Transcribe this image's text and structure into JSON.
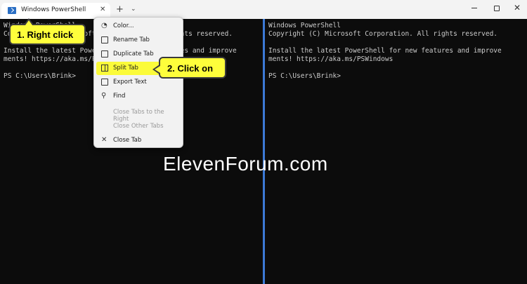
{
  "tab": {
    "title": "Windows PowerShell",
    "close_glyph": "✕"
  },
  "tabbar": {
    "new_tab_glyph": "+",
    "dropdown_glyph": "⌄"
  },
  "window_controls": {
    "close_glyph": "✕"
  },
  "terminal": {
    "left_lines": [
      "Windows PowerShell",
      "Copyright (C) Microsoft Corporation. All rights reserved.",
      "",
      "Install the latest PowerShell for new features and improve",
      "ments! https://aka.ms/PSWindows",
      "",
      "PS C:\\Users\\Brink>"
    ],
    "right_lines": [
      "Windows PowerShell",
      "Copyright (C) Microsoft Corporation. All rights reserved.",
      "",
      "Install the latest PowerShell for new features and improve",
      "ments! https://aka.ms/PSWindows",
      "",
      "PS C:\\Users\\Brink>"
    ]
  },
  "context_menu": {
    "items": [
      {
        "label": "Color...",
        "icon": "palette-icon",
        "enabled": true
      },
      {
        "label": "Rename Tab",
        "icon": "rename-icon",
        "enabled": true
      },
      {
        "label": "Duplicate Tab",
        "icon": "duplicate-icon",
        "enabled": true
      },
      {
        "label": "Split Tab",
        "icon": "split-icon",
        "enabled": true
      },
      {
        "label": "Export Text",
        "icon": "save-icon",
        "enabled": true
      },
      {
        "label": "Find",
        "icon": "search-icon",
        "enabled": true
      },
      {
        "label": "Close Tabs to the Right",
        "enabled": false
      },
      {
        "label": "Close Other Tabs",
        "enabled": false
      },
      {
        "label": "Close Tab",
        "icon": "close-icon",
        "enabled": true
      }
    ]
  },
  "callouts": {
    "step1": "1. Right click",
    "step2": "2. Click on"
  },
  "watermark": "ElevenForum.com",
  "colors": {
    "callout": "#fefe3b",
    "divider": "#3c7ad6",
    "terminal_bg": "#0c0c0c",
    "terminal_text": "#cccccc"
  }
}
